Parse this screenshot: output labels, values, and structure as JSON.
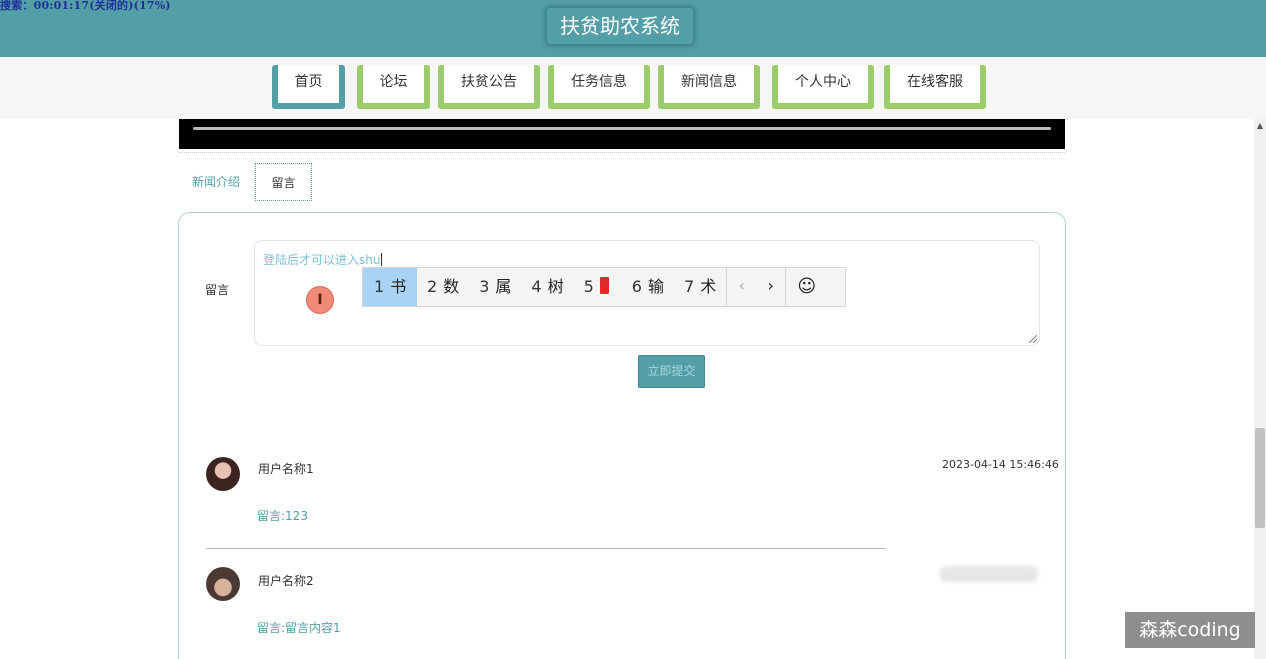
{
  "recorder_overlay": "搜索：00:01:17(关闭的)(17%)",
  "site": {
    "title": "扶贫助农系统"
  },
  "nav": {
    "items": [
      {
        "label": "首页",
        "active": true
      },
      {
        "label": "论坛"
      },
      {
        "label": "扶贫公告"
      },
      {
        "label": "任务信息"
      },
      {
        "label": "新闻信息"
      },
      {
        "label": "个人中心"
      },
      {
        "label": "在线客服"
      }
    ]
  },
  "tabs": [
    {
      "label": "新闻介绍"
    },
    {
      "label": "留言",
      "active": true
    }
  ],
  "form": {
    "label": "留言",
    "textarea_value": "登陆后才可以进入shu",
    "submit_label": "立即提交"
  },
  "ime": {
    "candidates": [
      {
        "num": "1",
        "text": "书"
      },
      {
        "num": "2",
        "text": "数"
      },
      {
        "num": "3",
        "text": "属"
      },
      {
        "num": "4",
        "text": "树"
      },
      {
        "num": "5",
        "icon": "book-icon"
      },
      {
        "num": "6",
        "text": "输"
      },
      {
        "num": "7",
        "text": "术"
      }
    ],
    "prev": "‹",
    "next": "›",
    "emoji": "☺"
  },
  "comments": [
    {
      "user": "用户名称1",
      "text": "留言:123",
      "time": "2023-04-14 15:46:46"
    },
    {
      "user": "用户名称2",
      "text": "留言:留言内容1"
    }
  ],
  "cursor_glyph": "I",
  "watermark": "森森coding",
  "colors": {
    "teal": "#539ea7",
    "green": "#9bcc6c",
    "ime_selected": "#a9d3f5"
  }
}
